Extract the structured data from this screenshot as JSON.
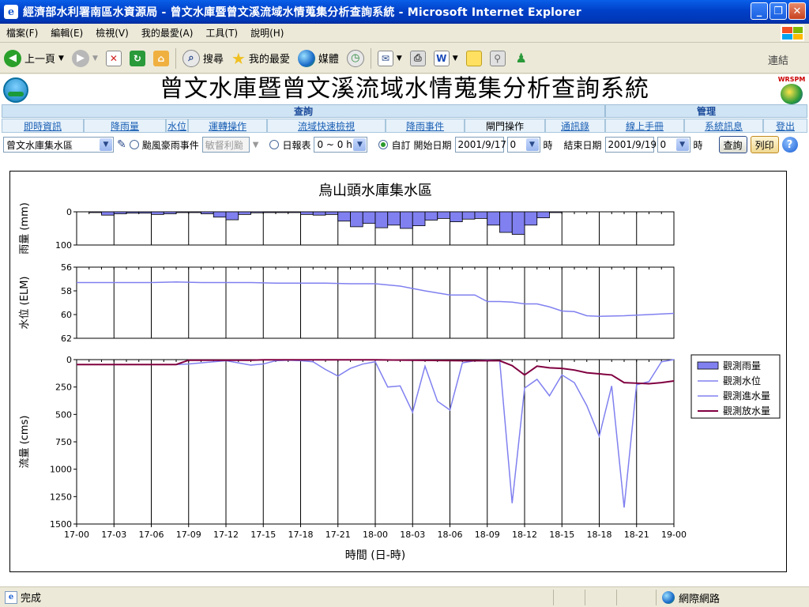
{
  "window": {
    "title": "經濟部水利署南區水資源局 - 曾文水庫暨曾文溪流域水情蒐集分析查詢系統 - Microsoft Internet Explorer",
    "icon": "ie-page-icon"
  },
  "menu": [
    "檔案(F)",
    "編輯(E)",
    "檢視(V)",
    "我的最愛(A)",
    "工具(T)",
    "說明(H)"
  ],
  "toolbar": {
    "back": "上一頁",
    "search": "搜尋",
    "favorites": "我的最愛",
    "media": "媒體",
    "links": "連結"
  },
  "page": {
    "title": "曾文水庫暨曾文溪流域水情蒐集分析查詢系統",
    "logo_right_text": "WRSPM",
    "nav_groups": [
      "查詢",
      "管理"
    ],
    "nav_items": [
      "即時資訊",
      "降雨量",
      "水位",
      "運轉操作",
      "流域快速檢視",
      "降雨事件",
      "閘門操作",
      "通訊錄",
      "線上手冊",
      "系統訊息",
      "登出"
    ]
  },
  "filter": {
    "area": "曾文水庫集水區",
    "typhoon_label": "颱風豪雨事件",
    "typhoon_value": "敏督利颱",
    "daily_label": "日報表",
    "daily_range": "0 ~ 0 hr",
    "custom_label": "自訂",
    "start_label": "開始日期",
    "start_date": "2001/9/17",
    "start_hour": "0",
    "hour_unit": "時",
    "end_label": "結束日期",
    "end_date": "2001/9/19",
    "end_hour": "0",
    "hour_unit2": "時",
    "query_button": "查詢",
    "print_button": "列印"
  },
  "chart_data": {
    "type": "line",
    "title": "烏山頭水庫集水區",
    "xlabel": "時間 (日-時)",
    "x_ticks": [
      "17-00",
      "17-03",
      "17-06",
      "17-09",
      "17-12",
      "17-15",
      "17-18",
      "17-21",
      "18-00",
      "18-03",
      "18-06",
      "18-09",
      "18-12",
      "18-15",
      "18-18",
      "18-21",
      "19-00"
    ],
    "rain": {
      "ylabel": "雨量 (mm)",
      "ylim": [
        100,
        0
      ],
      "y_ticks": [
        0,
        100
      ],
      "series_name": "觀測雨量",
      "color": "#8080f0",
      "values": [
        0,
        1,
        10,
        6,
        4,
        4,
        8,
        6,
        2,
        1,
        6,
        16,
        24,
        8,
        3,
        2,
        2,
        2,
        8,
        10,
        8,
        28,
        45,
        35,
        48,
        40,
        50,
        42,
        25,
        20,
        30,
        22,
        20,
        40,
        62,
        68,
        40,
        18,
        2,
        0,
        0,
        0,
        0,
        0,
        0,
        0,
        0,
        0
      ]
    },
    "level": {
      "ylabel": "水位 (ELM)",
      "ylim": [
        56,
        62
      ],
      "y_ticks": [
        56,
        58,
        60,
        62
      ],
      "series_name": "觀測水位",
      "color": "#8080f0",
      "x": [
        0,
        4,
        6,
        8,
        10,
        12,
        14,
        16,
        18,
        20,
        22,
        24,
        25,
        26,
        27,
        28,
        30,
        32,
        33,
        34,
        35,
        36,
        37,
        38,
        39,
        40,
        41,
        42,
        44,
        46,
        48
      ],
      "values": [
        57.3,
        57.3,
        57.3,
        57.25,
        57.3,
        57.3,
        57.3,
        57.35,
        57.35,
        57.35,
        57.4,
        57.4,
        57.5,
        57.6,
        57.8,
        58.0,
        58.35,
        58.35,
        58.9,
        58.9,
        58.95,
        59.1,
        59.1,
        59.35,
        59.7,
        59.75,
        60.1,
        60.15,
        60.1,
        60.0,
        59.9
      ]
    },
    "flow": {
      "ylabel": "流量 (cms)",
      "ylim": [
        0,
        1500
      ],
      "y_ticks": [
        0,
        250,
        500,
        750,
        1000,
        1250,
        1500
      ],
      "series": [
        {
          "name": "觀測進水量",
          "color": "#8080f0",
          "x": [
            0,
            4,
            8,
            9,
            10,
            11,
            12,
            13,
            14,
            15,
            16,
            17,
            18,
            19,
            20,
            21,
            22,
            23,
            24,
            25,
            26,
            27,
            28,
            29,
            30,
            31,
            32,
            33,
            34,
            35,
            36,
            37,
            38,
            39,
            40,
            41,
            42,
            43,
            44,
            45,
            46,
            47,
            48
          ],
          "values": [
            45,
            45,
            45,
            40,
            30,
            20,
            10,
            30,
            50,
            40,
            10,
            5,
            10,
            20,
            90,
            150,
            80,
            40,
            20,
            250,
            240,
            480,
            60,
            380,
            460,
            30,
            10,
            5,
            10,
            1310,
            260,
            180,
            330,
            140,
            210,
            420,
            700,
            240,
            1350,
            230,
            200,
            20,
            0
          ]
        },
        {
          "name": "觀測放水量",
          "color": "#800040",
          "x": [
            0,
            8,
            9,
            14,
            15,
            24,
            31,
            34,
            35,
            36,
            37,
            38,
            39,
            40,
            41,
            42,
            43,
            44,
            45,
            46,
            47,
            48
          ],
          "values": [
            45,
            45,
            5,
            5,
            2,
            2,
            10,
            10,
            55,
            140,
            60,
            75,
            80,
            95,
            120,
            130,
            140,
            210,
            215,
            220,
            210,
            195
          ]
        }
      ]
    },
    "legend": [
      "觀測雨量",
      "觀測水位",
      "觀測進水量",
      "觀測放水量"
    ],
    "legend_position": "right",
    "grid": true
  },
  "status": {
    "text": "完成",
    "zone": "網際網路"
  }
}
